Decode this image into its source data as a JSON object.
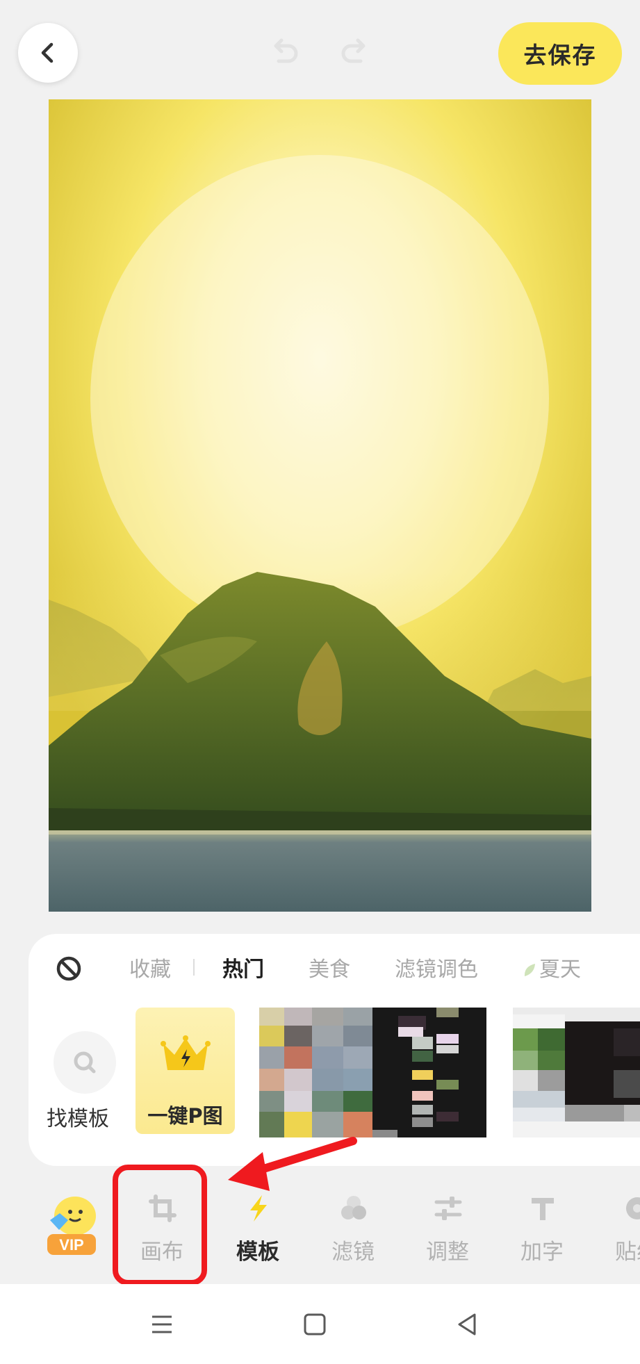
{
  "topbar": {
    "back_icon": "chevron-left-icon",
    "undo_icon": "undo-icon",
    "redo_icon": "redo-icon",
    "save_label": "去保存",
    "save_color": "#fbe75a"
  },
  "canvas": {
    "description_icon": "landscape-photo",
    "sky_color": "#f7ec7e",
    "mountain_color": "#4f6a24",
    "water_color": "#5c7377"
  },
  "templates": {
    "no_template_icon": "prohibit-icon",
    "categories": [
      {
        "label": "收藏",
        "active": false
      },
      {
        "label": "热门",
        "active": true
      },
      {
        "label": "美食",
        "active": false
      },
      {
        "label": "滤镜调色",
        "active": false
      },
      {
        "label": "夏天",
        "active": false,
        "icon": "leaf-icon"
      }
    ],
    "find_label": "找模板",
    "find_icon": "search-icon",
    "oneclick_label": "一键P图",
    "oneclick_icon": "crown-lightning-icon"
  },
  "tools": {
    "vip_label": "VIP",
    "items": [
      {
        "label": "画布",
        "icon": "crop-icon",
        "active": false
      },
      {
        "label": "模板",
        "icon": "lightning-icon",
        "active": true
      },
      {
        "label": "滤镜",
        "icon": "filter-icon",
        "active": false
      },
      {
        "label": "调整",
        "icon": "sliders-icon",
        "active": false
      },
      {
        "label": "加字",
        "icon": "text-icon",
        "active": false
      },
      {
        "label": "贴纸",
        "icon": "sticker-icon",
        "active": false
      }
    ],
    "highlight_color": "#ef1a1f"
  },
  "navbar": {
    "menu_icon": "menu-icon",
    "home_icon": "home-square-icon",
    "back_icon": "back-triangle-icon"
  }
}
